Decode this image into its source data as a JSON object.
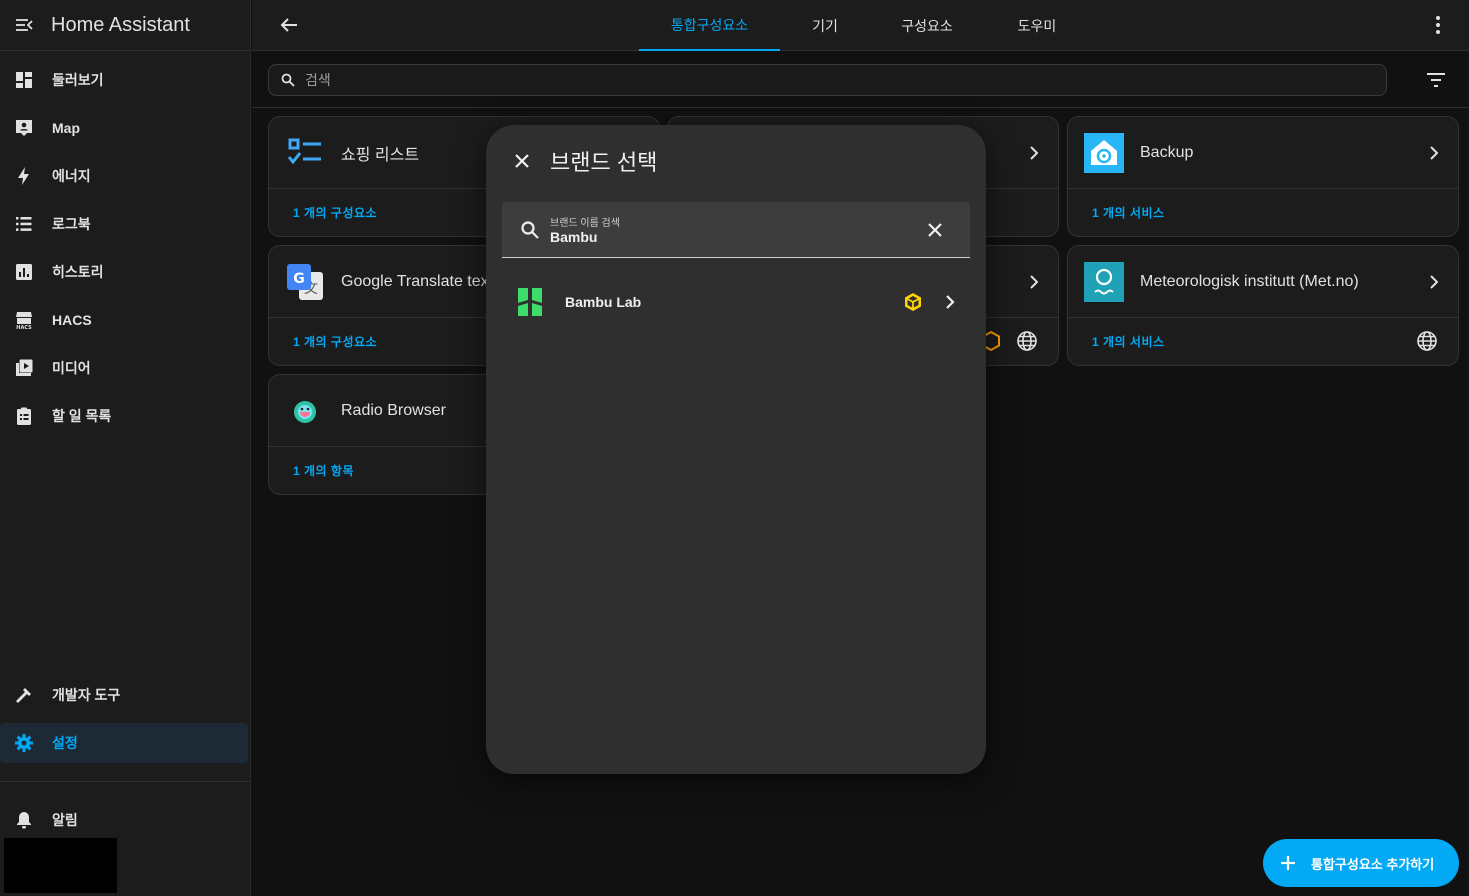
{
  "sidebar": {
    "title": "Home Assistant",
    "items": [
      {
        "label": "둘러보기",
        "icon": "dashboard-icon"
      },
      {
        "label": "Map",
        "icon": "map-account-icon"
      },
      {
        "label": "에너지",
        "icon": "lightning-icon"
      },
      {
        "label": "로그북",
        "icon": "list-icon"
      },
      {
        "label": "히스토리",
        "icon": "chart-box-icon"
      },
      {
        "label": "HACS",
        "icon": "hacs-store-icon"
      },
      {
        "label": "미디어",
        "icon": "media-play-icon"
      },
      {
        "label": "할 일 목록",
        "icon": "clipboard-list-icon"
      }
    ],
    "developer_tools": "개발자 도구",
    "settings": "설정",
    "notifications": "알림"
  },
  "topbar": {
    "tabs": [
      "통합구성요소",
      "기기",
      "구성요소",
      "도우미"
    ],
    "active_tab": 0
  },
  "search": {
    "placeholder": "검색"
  },
  "cards": [
    {
      "name": "쇼핑 리스트",
      "footer": "1 개의 구성요소"
    },
    {
      "name": "Google Translate tex",
      "footer": "1 개의 구성요소"
    },
    {
      "name": "Radio Browser",
      "footer": "1 개의 항목"
    },
    {
      "name": "Backup",
      "footer": "1 개의 서비스"
    },
    {
      "name": "Meteorologisk institutt (Met.no)",
      "footer": "1 개의 서비스"
    }
  ],
  "fab": {
    "label": "통합구성요소 추가하기"
  },
  "dialog": {
    "title": "브랜드 선택",
    "search_label": "브랜드 이름 검색",
    "search_value": "Bambu",
    "results": [
      {
        "name": "Bambu Lab"
      }
    ]
  },
  "colors": {
    "accent": "#03a9f4",
    "bambu_green": "#3ddc6b",
    "hacs_yellow": "#ffd400",
    "backup_blue": "#29b6f6",
    "metno_teal": "#1fa2b5"
  }
}
